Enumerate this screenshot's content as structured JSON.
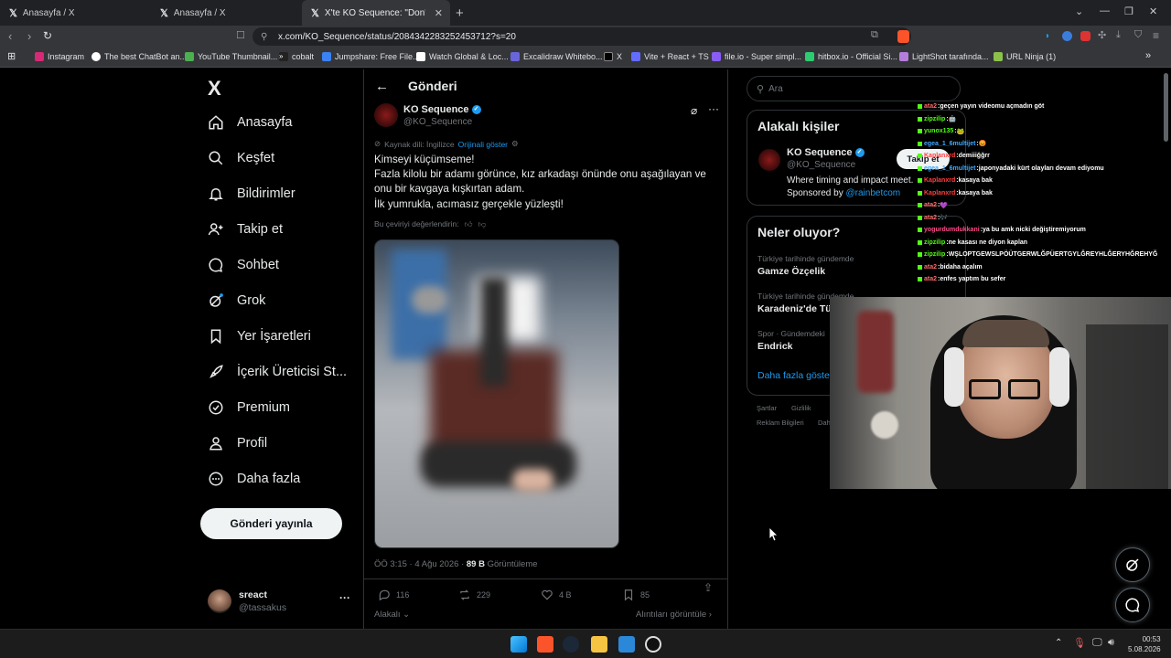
{
  "browser": {
    "tabs": [
      {
        "label": "Anasayfa / X"
      },
      {
        "label": "Anasayfa / X"
      },
      {
        "label": "X'te KO Sequence: \"Don't loo"
      }
    ],
    "url": "x.com/KO_Sequence/status/2084342283252453712?s=20",
    "bookmarks": [
      "Instagram",
      "The best ChatBot an...",
      "YouTube Thumbnail...",
      "cobalt",
      "Jumpshare: Free File...",
      "Watch Global & Loc...",
      "Excalidraw Whitebo...",
      "X",
      "Vite + React + TS",
      "file.io - Super simpl...",
      "hitbox.io - Official Si...",
      "LightShot tarafında...",
      "URL Ninja (1)"
    ]
  },
  "nav": {
    "logo": "X",
    "items": [
      {
        "label": "Anasayfa"
      },
      {
        "label": "Keşfet"
      },
      {
        "label": "Bildirimler"
      },
      {
        "label": "Takip et"
      },
      {
        "label": "Sohbet"
      },
      {
        "label": "Grok"
      },
      {
        "label": "Yer İşaretleri"
      },
      {
        "label": "İçerik Üreticisi St..."
      },
      {
        "label": "Premium"
      },
      {
        "label": "Profil"
      },
      {
        "label": "Daha fazla"
      }
    ],
    "post_button": "Gönderi yayınla",
    "account": {
      "name": "sreact",
      "handle": "@tassakus"
    }
  },
  "post": {
    "header_title": "Gönderi",
    "author_name": "KO Sequence",
    "author_handle": "@KO_Sequence",
    "translated_from": "Kaynak dili: İngilizce",
    "show_original": "Orijinali göster",
    "text_lines": [
      "Kimseyi küçümseme!",
      "Fazla kilolu bir adamı görünce, kız arkadaşı önünde onu aşağılayan ve",
      "onu bir kavgaya kışkırtan adam.",
      "İlk yumrukla, acımasız gerçekle yüzleşti!"
    ],
    "rate_translation": "Bu çeviriyi değerlendirin:",
    "time": "ÖÖ 3:15 · 4 Ağu 2026 ·",
    "views_value": "89 B",
    "views_label": "Görüntüleme",
    "replies": "116",
    "reposts": "229",
    "likes": "4 B",
    "bookmarks": "85",
    "related_label": "Alakalı",
    "quotes_label": "Alıntıları görüntüle"
  },
  "sidebar": {
    "search_placeholder": "Ara",
    "relevant_title": "Alakalı kişiler",
    "person": {
      "name": "KO Sequence",
      "handle": "@KO_Sequence",
      "bio_line1": "Where timing and impact meet.",
      "bio_line2_prefix": "Sponsored by ",
      "bio_line2_link": "@rainbetcom",
      "follow": "Takip et"
    },
    "trends_title": "Neler oluyor?",
    "trends": [
      {
        "context": "Türkiye tarihinde gündemde",
        "name": "Gamze Özçelik"
      },
      {
        "context": "Türkiye tarihinde gündemde",
        "name": "Karadeniz'de Tür"
      },
      {
        "context": "Spor · Gündemdeki",
        "name": "Endrick"
      }
    ],
    "show_more": "Daha fazla göster",
    "footer": [
      "Şartlar",
      "Gizlilik",
      "Reklam Bilgileri",
      "Dah"
    ]
  },
  "chat": [
    {
      "user": "ata2",
      "msg": "geçen yayın videomu açmadın göt",
      "color": "#ff6b6b"
    },
    {
      "user": "zipzilip",
      "msg": "🤖",
      "color": "#53fc18"
    },
    {
      "user": "yunox135",
      "msg": "🐸",
      "color": "#53fc18"
    },
    {
      "user": "egea_1_6multijet",
      "msg": "😡",
      "color": "#3fa9ff"
    },
    {
      "user": "Kaplanxrd",
      "msg": "demiiiğğrr",
      "color": "#ff4040"
    },
    {
      "user": "egea_1_6multijet",
      "msg": "japonyadaki kürt olayları devam ediyomu",
      "color": "#3fa9ff"
    },
    {
      "user": "Kaplanxrd",
      "msg": "kasaya bak",
      "color": "#ff4040"
    },
    {
      "user": "Kaplanxrd",
      "msg": "kasaya bak",
      "color": "#ff4040"
    },
    {
      "user": "ata2",
      "msg": "💜",
      "color": "#ff6b6b"
    },
    {
      "user": "ata2",
      "msg": "🎶",
      "color": "#ff6b6b"
    },
    {
      "user": "yogurdumdukkani",
      "msg": "ya bu amk nicki değiştiremiyorum",
      "color": "#ff4b8b"
    },
    {
      "user": "zipzilip",
      "msg": "ne kasası ne diyon kaplan",
      "color": "#53fc18"
    },
    {
      "user": "zipzilip",
      "msg": "WŞLOPTGEWSLPÖÜTGERWLĞPÜERTGYLĞREYHLĞERYHĞREHYĞ",
      "color": "#53fc18"
    },
    {
      "user": "ata2",
      "msg": "bidaha açalım",
      "color": "#ff6b6b"
    },
    {
      "user": "ata2",
      "msg": "enfes yaptım bu sefer",
      "color": "#ff6b6b"
    }
  ],
  "taskbar": {
    "time": "00:53",
    "date": "5.08.2026"
  }
}
